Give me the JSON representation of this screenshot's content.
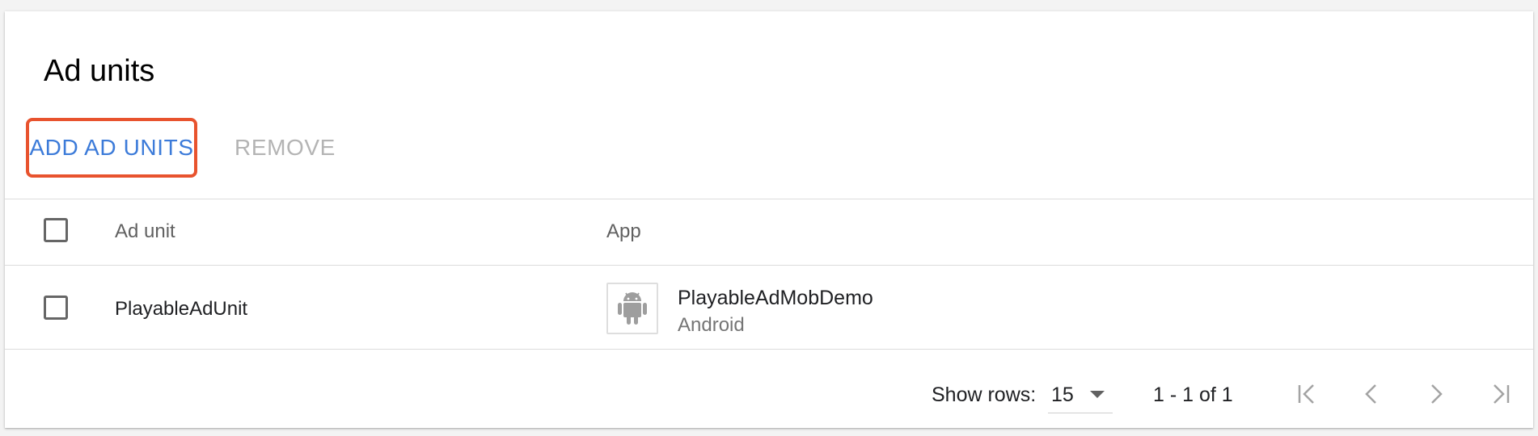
{
  "page": {
    "title": "Ad units"
  },
  "toolbar": {
    "add_label": "ADD AD UNITS",
    "remove_label": "REMOVE"
  },
  "table": {
    "columns": [
      "Ad unit",
      "App"
    ],
    "rows": [
      {
        "ad_unit": "PlayableAdUnit",
        "app_name": "PlayableAdMobDemo",
        "app_platform": "Android",
        "app_icon": "android-icon"
      }
    ]
  },
  "footer": {
    "show_rows_label": "Show rows:",
    "rows_value": "15",
    "range_text": "1 - 1 of 1"
  },
  "colors": {
    "accent": "#3c7bd9",
    "highlight_border": "#e8532e",
    "disabled": "#b4b4b4"
  }
}
